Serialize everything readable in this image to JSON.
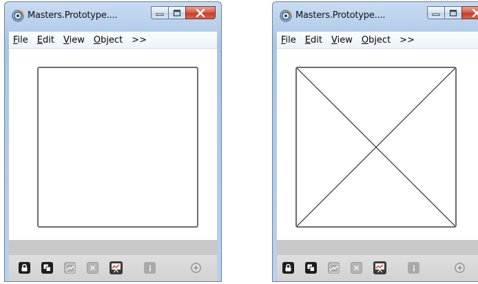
{
  "windows": [
    {
      "title": "Masters.Prototype....",
      "menu": [
        {
          "accel": "F",
          "rest": "ile"
        },
        {
          "accel": "E",
          "rest": "dit"
        },
        {
          "accel": "V",
          "rest": "iew"
        },
        {
          "accel": "O",
          "rest": "bject"
        },
        {
          "accel": "",
          "rest": ">>"
        }
      ],
      "canvas_variant": "empty-frame"
    },
    {
      "title": "Masters.Prototype....",
      "menu": [
        {
          "accel": "F",
          "rest": "ile"
        },
        {
          "accel": "E",
          "rest": "dit"
        },
        {
          "accel": "V",
          "rest": "iew"
        },
        {
          "accel": "O",
          "rest": "bject"
        },
        {
          "accel": "",
          "rest": ">>"
        }
      ],
      "canvas_variant": "placeholder-cross"
    }
  ],
  "toolbar_icons": [
    "lock-icon",
    "layers-icon",
    "photo-icon",
    "delete-icon",
    "chart-icon",
    "info-icon",
    "add-icon"
  ],
  "colors": {
    "title_gradient": "#b9d1ec",
    "close_button": "#c63d27",
    "frame_stroke": "#6b6b6b",
    "status_bar": "#c8c8c8",
    "toolbar": "#d2d2d2"
  }
}
